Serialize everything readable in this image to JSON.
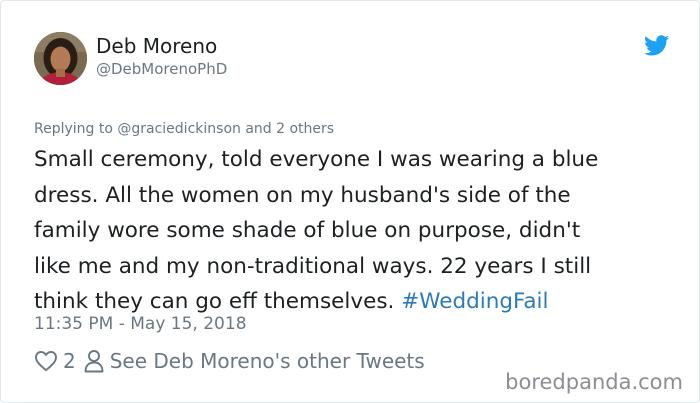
{
  "tweet": {
    "author_name": "Deb Moreno",
    "author_handle": "@DebMorenoPhD",
    "replying_to": "Replying to @graciedickinson and 2 others",
    "text": "Small ceremony, told everyone I was wearing a blue\ndress. All the women on my husband's side of the\nfamily wore some shade of blue on purpose, didn't\nlike me and my non-traditional ways. 22 years I still\nthink they can go eff themselves. ",
    "hashtag": "#WeddingFail",
    "timestamp": "11:35 PM - May 15, 2018",
    "like_count": "2",
    "profile_link": "See Deb Moreno's other Tweets"
  },
  "watermark": "boredpanda.com",
  "icons": {
    "brand": "twitter-bird-icon",
    "like": "heart-outline-icon",
    "profile": "person-outline-icon"
  },
  "colors": {
    "text": "#1c2022",
    "secondary": "#697882",
    "link": "#2b7bb9",
    "twitter_blue": "#1da1f2",
    "watermark": "#8a8f93"
  }
}
